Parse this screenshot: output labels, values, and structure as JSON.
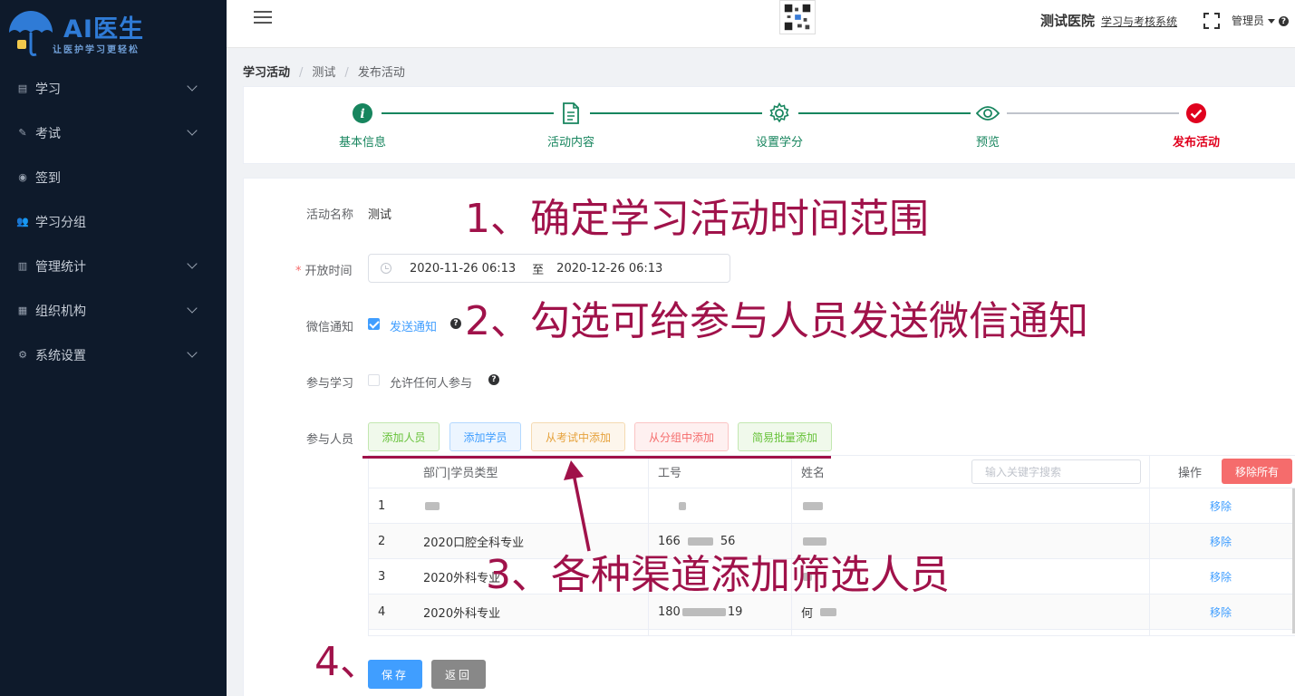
{
  "logo": {
    "brand": "AI医生",
    "slogan": "让医护学习更轻松"
  },
  "sidebar": {
    "items": [
      {
        "label": "学习",
        "icon": "list-icon",
        "has_children": true
      },
      {
        "label": "考试",
        "icon": "edit-icon",
        "has_children": true
      },
      {
        "label": "签到",
        "icon": "location-icon",
        "has_children": false
      },
      {
        "label": "学习分组",
        "icon": "user-group-icon",
        "has_children": false
      },
      {
        "label": "管理统计",
        "icon": "bar-chart-icon",
        "has_children": true
      },
      {
        "label": "组织机构",
        "icon": "building-icon",
        "has_children": true
      },
      {
        "label": "系统设置",
        "icon": "gear-icon",
        "has_children": true
      }
    ]
  },
  "header": {
    "hospital": "测试医院",
    "system_link": "学习与考核系统",
    "user": "管理员"
  },
  "breadcrumb": [
    "学习活动",
    "测试",
    "发布活动"
  ],
  "steps": [
    {
      "title": "基本信息",
      "icon": "info-icon"
    },
    {
      "title": "活动内容",
      "icon": "document-icon"
    },
    {
      "title": "设置学分",
      "icon": "gear-icon"
    },
    {
      "title": "预览",
      "icon": "eye-icon"
    },
    {
      "title": "发布活动",
      "icon": "check-icon"
    }
  ],
  "form": {
    "activity_name_label": "活动名称",
    "activity_name_value": "测试",
    "open_time_label": "开放时间",
    "start_time": "2020-11-26 06:13",
    "range_sep": "至",
    "end_time": "2020-12-26 06:13",
    "wechat_label": "微信通知",
    "wechat_option": "发送通知",
    "wechat_checked": true,
    "join_label": "参与学习",
    "join_option": "允许任何人参与",
    "join_checked": false,
    "participants_label": "参与人员",
    "add_buttons": [
      "添加人员",
      "添加学员",
      "从考试中添加",
      "从分组中添加",
      "简易批量添加"
    ]
  },
  "table": {
    "columns": [
      "部门|学员类型",
      "工号",
      "姓名",
      "操作"
    ],
    "search_placeholder": "输入关键字搜索",
    "remove_all": "移除所有",
    "remove_label": "移除",
    "rows": [
      {
        "index": "1",
        "dept": "",
        "id_prefix": "",
        "id_suffix": "",
        "name_prefix": ""
      },
      {
        "index": "2",
        "dept": "2020口腔全科专业",
        "id_prefix": "166",
        "id_suffix": "56",
        "name_prefix": ""
      },
      {
        "index": "3",
        "dept": "2020外科专业",
        "id_prefix": "",
        "id_suffix": "",
        "name_prefix": ""
      },
      {
        "index": "4",
        "dept": "2020外科专业",
        "id_prefix": "180",
        "id_suffix": "19",
        "name_prefix": "何"
      }
    ]
  },
  "actions": {
    "save": "保存",
    "back": "返回"
  },
  "annotations": {
    "a1": "1、确定学习活动时间范围",
    "a2": "2、勾选可给参与人员发送微信通知",
    "a3": "3、各种渠道添加筛选人员",
    "a4": "4、"
  },
  "colors": {
    "sidebar_bg": "#0e1a2b",
    "step_green": "#17855e",
    "step_red": "#e0021e",
    "primary": "#409eff",
    "danger": "#f56c6c",
    "annotation": "#a0124a"
  }
}
